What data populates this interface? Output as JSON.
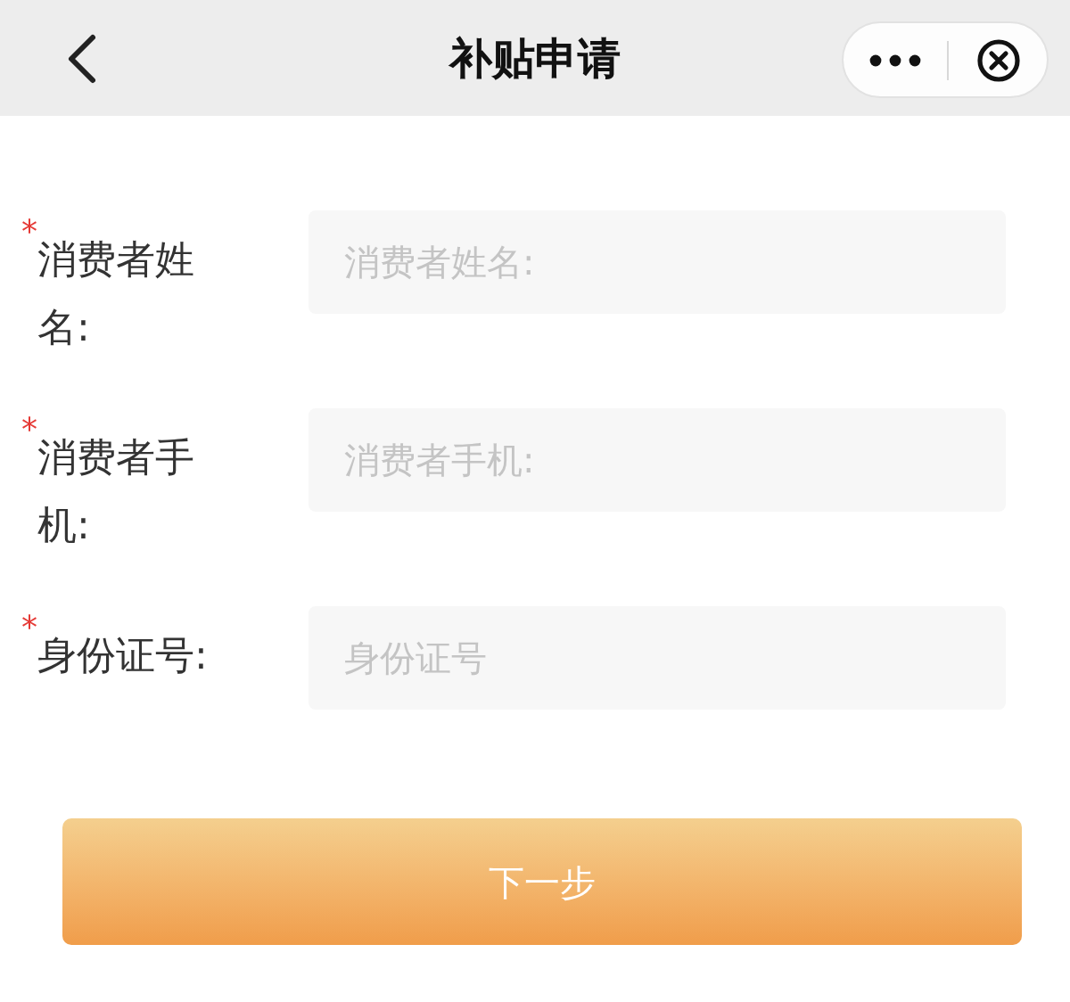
{
  "nav_bar": {
    "title": "补贴申请"
  },
  "fields": [
    {
      "required_mark": "*",
      "label": "消费者姓名:",
      "placeholder": "消费者姓名:"
    },
    {
      "required_mark": "*",
      "label": "消费者手机:",
      "placeholder": "消费者手机:"
    },
    {
      "required_mark": "*",
      "label": "身份证号:",
      "placeholder": "身份证号"
    }
  ],
  "next_button": "下一步"
}
